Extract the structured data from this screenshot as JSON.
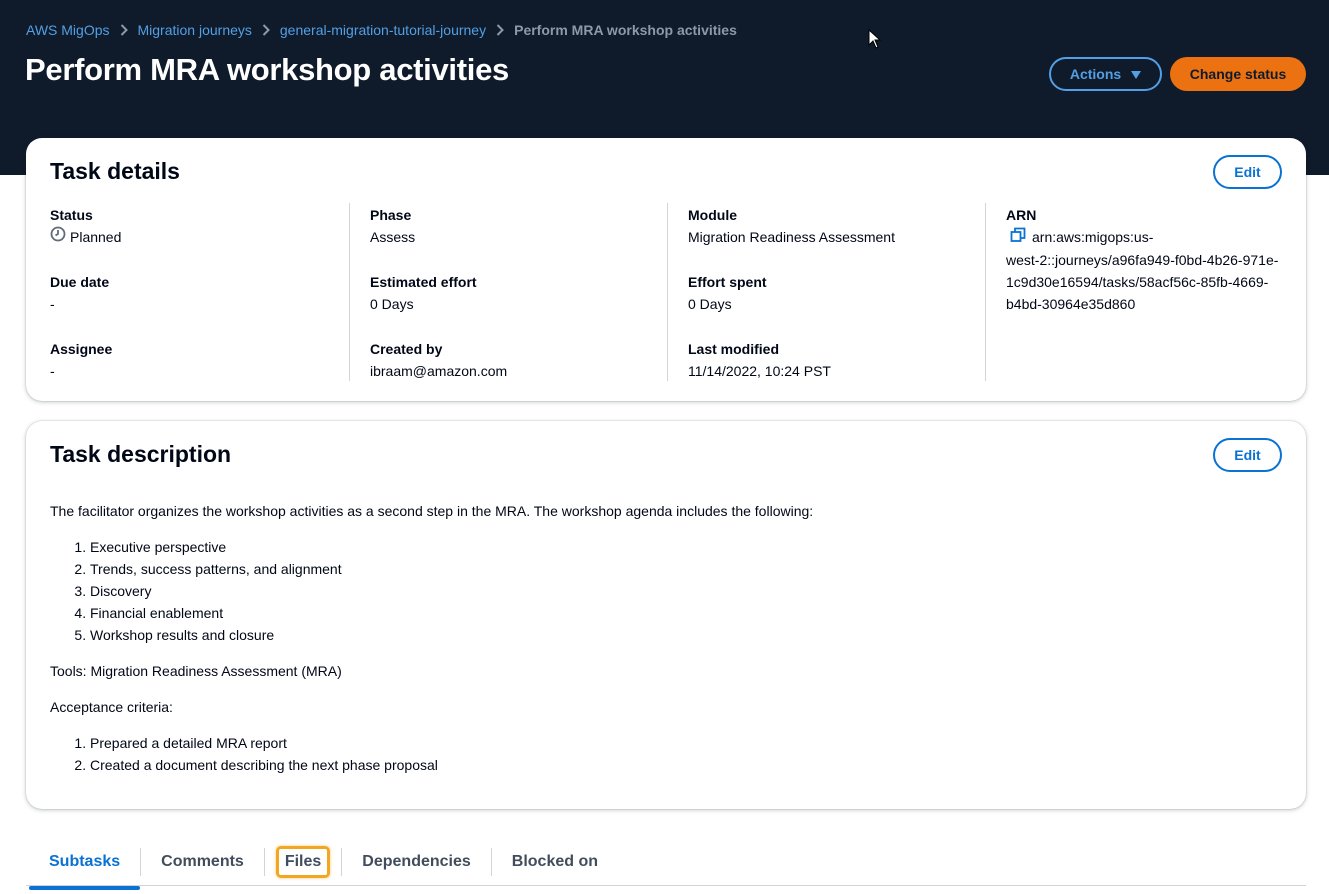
{
  "breadcrumb": {
    "items": [
      "AWS MigOps",
      "Migration journeys",
      "general-migration-tutorial-journey"
    ],
    "current": "Perform MRA workshop activities"
  },
  "header": {
    "title": "Perform MRA workshop activities",
    "actions_label": "Actions",
    "change_status_label": "Change status"
  },
  "task_details": {
    "title": "Task details",
    "edit_label": "Edit",
    "status": {
      "label": "Status",
      "value": "Planned"
    },
    "due_date": {
      "label": "Due date",
      "value": "-"
    },
    "assignee": {
      "label": "Assignee",
      "value": "-"
    },
    "phase": {
      "label": "Phase",
      "value": "Assess"
    },
    "estimated_effort": {
      "label": "Estimated effort",
      "value": "0 Days"
    },
    "created_by": {
      "label": "Created by",
      "value": "ibraam@amazon.com"
    },
    "module": {
      "label": "Module",
      "value": "Migration Readiness Assessment"
    },
    "effort_spent": {
      "label": "Effort spent",
      "value": "0 Days"
    },
    "last_modified": {
      "label": "Last modified",
      "value": "11/14/2022, 10:24 PST"
    },
    "arn": {
      "label": "ARN",
      "lines": [
        "arn:aws:migops:us-",
        "west-2::journeys/a96fa949-f0bd-4b26-971e-",
        "1c9d30e16594/tasks/58acf56c-85fb-4669-",
        "b4bd-30964e35d860"
      ]
    }
  },
  "task_description": {
    "title": "Task description",
    "edit_label": "Edit",
    "intro": "The facilitator organizes the workshop activities as a second step in the MRA. The workshop agenda includes the following:",
    "agenda": [
      "Executive perspective",
      "Trends, success patterns, and alignment",
      "Discovery",
      "Financial enablement",
      "Workshop results and closure"
    ],
    "tools": "Tools: Migration Readiness Assessment (MRA)",
    "acceptance_heading": "Acceptance criteria:",
    "acceptance": [
      "Prepared a detailed MRA report",
      "Created a document describing the next phase proposal"
    ]
  },
  "tabs": [
    "Subtasks",
    "Comments",
    "Files",
    "Dependencies",
    "Blocked on"
  ],
  "colors": {
    "header_bg": "#0f1b2a",
    "link": "#539fe5",
    "primary": "#0972d3",
    "accent": "#ec7211",
    "highlight": "#f2a722"
  }
}
